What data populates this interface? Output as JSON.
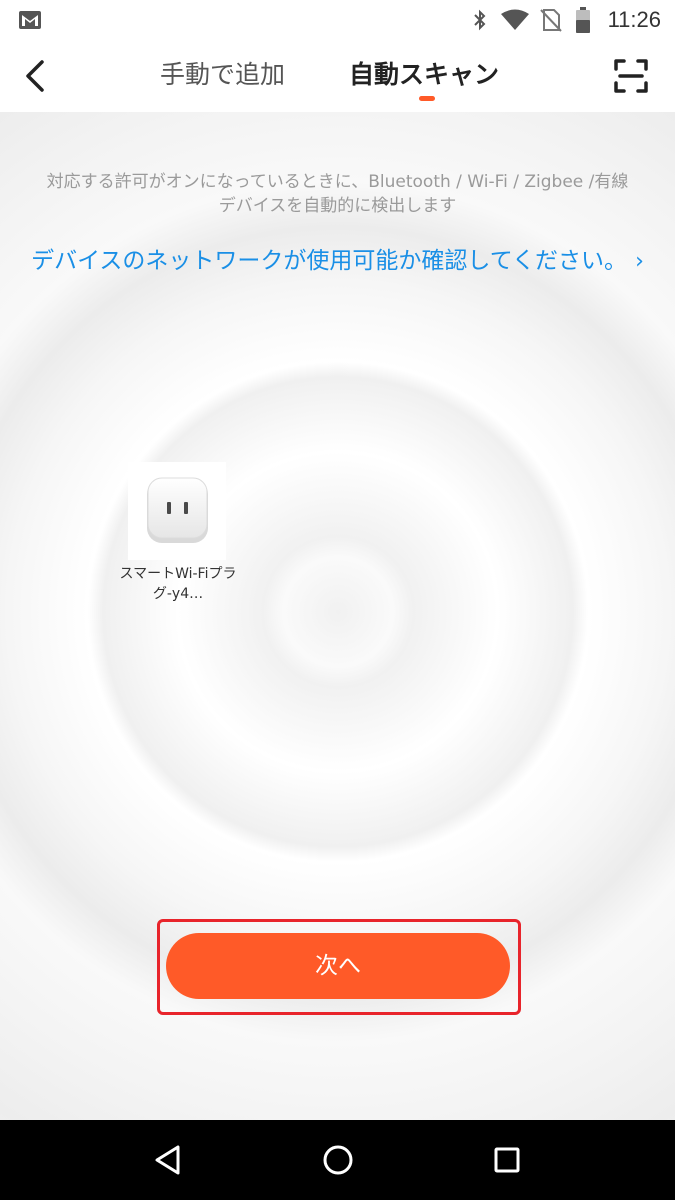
{
  "status_bar": {
    "time": "11:26",
    "icons": [
      "gmail-icon",
      "bluetooth-icon",
      "wifi-icon",
      "no-sim-icon",
      "battery-icon"
    ]
  },
  "header": {
    "tabs": [
      {
        "label": "手動で追加",
        "active": false
      },
      {
        "label": "自動スキャン",
        "active": true
      }
    ],
    "accent_color": "#ff5a28"
  },
  "main": {
    "info_text": "対応する許可がオンになっているときに、Bluetooth / Wi-Fi / Zigbee /有線\nデバイスを自動的に検出します",
    "network_link": "デバイスのネットワークが使用可能か確認してください。",
    "link_chevron": "›",
    "link_color": "#1a8fe6",
    "devices": [
      {
        "name": "スマートWi-Fiプラグ-y4…",
        "icon": "smart-plug-icon"
      }
    ]
  },
  "footer": {
    "next_label": "次へ",
    "button_color": "#ff5a28",
    "highlight_color": "#e8242b"
  },
  "nav_bar": {
    "icons": [
      "back-triangle-icon",
      "home-circle-icon",
      "recents-square-icon"
    ]
  }
}
